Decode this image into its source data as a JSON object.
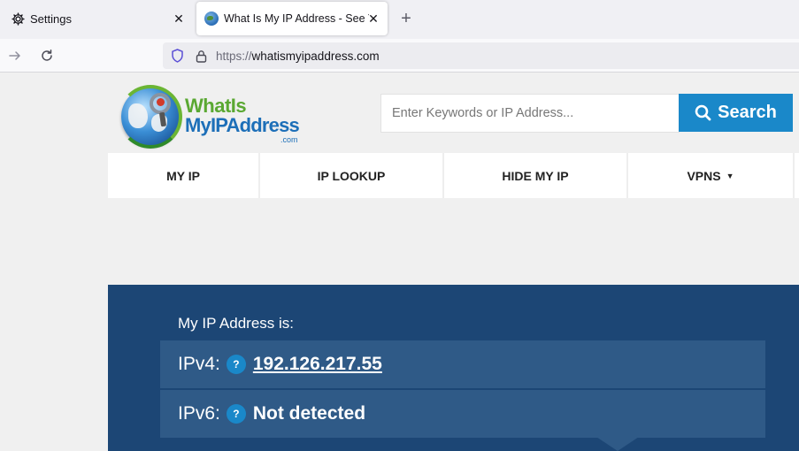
{
  "browser": {
    "tabs": [
      {
        "title": "Settings",
        "icon": "gear-icon"
      },
      {
        "title": "What Is My IP Address - See Yo",
        "icon": "globe-favicon",
        "active": true
      }
    ],
    "new_tab_symbol": "+",
    "close_symbol": "✕",
    "url": {
      "protocol": "https://",
      "host": "whatismyipaddress.com"
    }
  },
  "site": {
    "logo": {
      "line1": "WhatIs",
      "line2": "MyIPAddress",
      "suffix": ".com"
    },
    "search": {
      "placeholder": "Enter Keywords or IP Address...",
      "button_label": "Search"
    },
    "nav": [
      {
        "label": "MY IP"
      },
      {
        "label": "IP LOOKUP"
      },
      {
        "label": "HIDE MY IP"
      },
      {
        "label": "VPNS",
        "has_dropdown": true
      }
    ],
    "ip_panel": {
      "heading": "My IP Address is:",
      "ipv4_label": "IPv4:",
      "ipv4_value": "192.126.217.55",
      "ipv6_label": "IPv6:",
      "ipv6_value": "Not detected",
      "help_symbol": "?"
    }
  },
  "colors": {
    "brand_blue": "#1a88c9",
    "panel_bg": "#1c4675",
    "row_bg": "#2f5a87",
    "logo_green": "#5aa832",
    "logo_blue": "#1d6fb8"
  }
}
